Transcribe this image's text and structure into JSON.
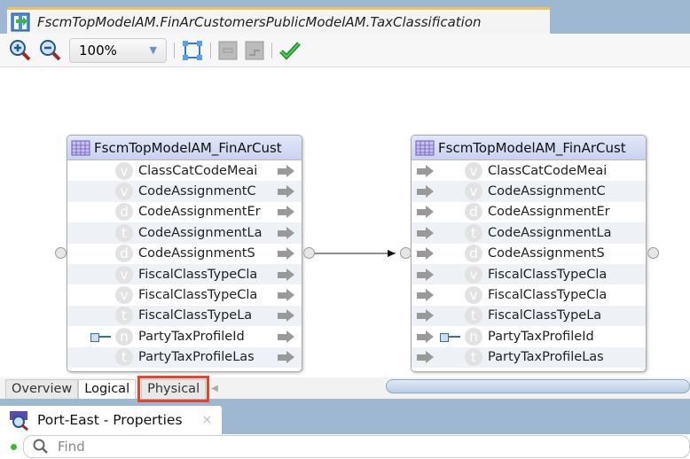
{
  "editor": {
    "title": "FscmTopModelAM.FinArCustomersPublicModelAM.TaxClassification"
  },
  "toolbar": {
    "zoom_value": "100%"
  },
  "diagram": {
    "left_entity": {
      "title": "FscmTopModelAM_FinArCust"
    },
    "right_entity": {
      "title": "FscmTopModelAM_FinArCust"
    },
    "attributes": [
      {
        "type": "v",
        "name": "ClassCatCodeMeaning",
        "display": "ClassCatCodeMeai"
      },
      {
        "type": "v",
        "name": "CodeAssignmentC",
        "display": "CodeAssignmentC"
      },
      {
        "type": "d",
        "name": "CodeAssignmentEnd",
        "display": "CodeAssignmentEr"
      },
      {
        "type": "t",
        "name": "CodeAssignmentLast",
        "display": "CodeAssignmentLa"
      },
      {
        "type": "d",
        "name": "CodeAssignmentStart",
        "display": "CodeAssignmentS"
      },
      {
        "type": "v",
        "name": "FiscalClassTypeCla",
        "display": "FiscalClassTypeCla"
      },
      {
        "type": "v",
        "name": "FiscalClassTypeCla",
        "display": "FiscalClassTypeCla"
      },
      {
        "type": "t",
        "name": "FiscalClassTypeLast",
        "display": "FiscalClassTypeLa"
      },
      {
        "type": "n",
        "name": "PartyTaxProfileId",
        "display": "PartyTaxProfileId",
        "key": true
      },
      {
        "type": "t",
        "name": "PartyTaxProfileLast",
        "display": "PartyTaxProfileLas"
      }
    ]
  },
  "bottom_tabs": [
    "Overview",
    "Logical",
    "Physical"
  ],
  "properties": {
    "title": "Port-East - Properties",
    "close": "×",
    "find_placeholder": "Find"
  }
}
